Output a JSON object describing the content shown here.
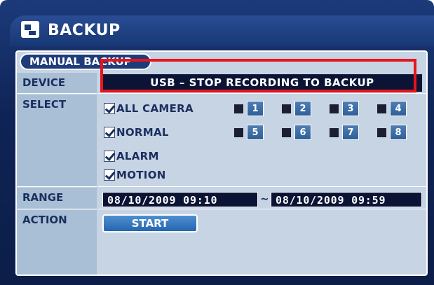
{
  "window": {
    "title": "BACKUP",
    "icon": "backup-icon"
  },
  "panel": {
    "tab_label": "MANUAL BACKUP"
  },
  "rows": {
    "device_label": "DEVICE",
    "select_label": "SELECT",
    "range_label": "RANGE",
    "action_label": "ACTION"
  },
  "device": {
    "value": "USB – STOP RECORDING TO BACKUP"
  },
  "select": {
    "options": [
      {
        "label": "ALL CAMERA",
        "checked": true
      },
      {
        "label": "NORMAL",
        "checked": true
      },
      {
        "label": "ALARM",
        "checked": true
      },
      {
        "label": "MOTION",
        "checked": true
      }
    ],
    "cameras": [
      "1",
      "2",
      "3",
      "4",
      "5",
      "6",
      "7",
      "8"
    ]
  },
  "range": {
    "start": "08/10/2009  09:10",
    "separator": "~",
    "end": "08/10/2009  09:59"
  },
  "action": {
    "start_label": "START"
  },
  "colors": {
    "highlight": "#e8141c",
    "frame": "#1c3a7a",
    "panel": "#c7d4e4"
  }
}
